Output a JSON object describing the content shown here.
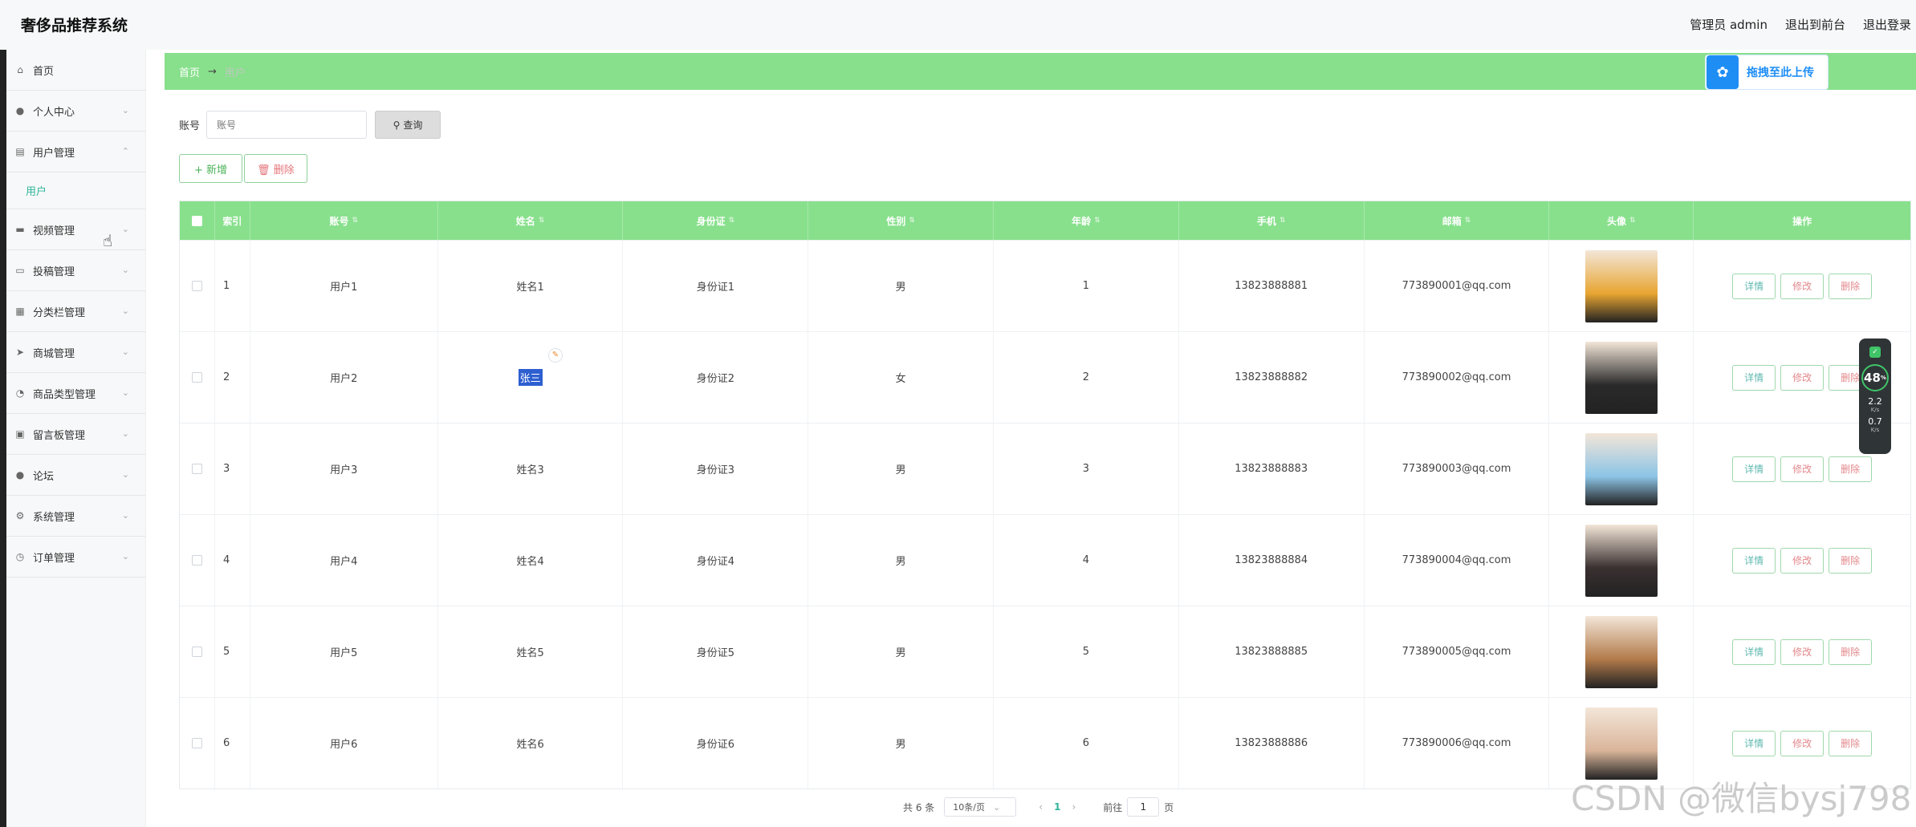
{
  "header": {
    "title": "奢侈品推荐系统",
    "links": [
      "管理员 admin",
      "退出到前台",
      "退出登录"
    ]
  },
  "sidebar": {
    "items": [
      {
        "label": "首页",
        "icon": "home-icon",
        "glyph": "⌂",
        "chev": ""
      },
      {
        "label": "个人中心",
        "icon": "user-icon",
        "glyph": "●",
        "chev": "⌄"
      },
      {
        "label": "用户管理",
        "icon": "clipboard-icon",
        "glyph": "▤",
        "chev": "⌃"
      },
      {
        "label": "视频管理",
        "icon": "briefcase-icon",
        "glyph": "▬",
        "chev": "⌄"
      },
      {
        "label": "投稿管理",
        "icon": "ticket-icon",
        "glyph": "▭",
        "chev": "⌄"
      },
      {
        "label": "分类栏管理",
        "icon": "grid-icon",
        "glyph": "▦",
        "chev": "⌄"
      },
      {
        "label": "商城管理",
        "icon": "send-icon",
        "glyph": "➤",
        "chev": "⌄"
      },
      {
        "label": "商品类型管理",
        "icon": "gauge-icon",
        "glyph": "◔",
        "chev": "⌄"
      },
      {
        "label": "留言板管理",
        "icon": "notebook-icon",
        "glyph": "▣",
        "chev": "⌄"
      },
      {
        "label": "论坛",
        "icon": "person-icon",
        "glyph": "●",
        "chev": "⌄"
      },
      {
        "label": "系统管理",
        "icon": "cog-icon",
        "glyph": "⚙",
        "chev": "⌄"
      },
      {
        "label": "订单管理",
        "icon": "clock-icon",
        "glyph": "◷",
        "chev": "⌄"
      }
    ],
    "sub_item": "用户"
  },
  "breadcrumb": {
    "home": "首页",
    "arrow": "→",
    "current": "用户"
  },
  "upload": {
    "label": "拖拽至此上传"
  },
  "search": {
    "label": "账号",
    "placeholder": "账号",
    "button": "查询"
  },
  "actions": {
    "add": "+ 新增",
    "delete": "🗑 删除"
  },
  "table": {
    "headers": [
      "索引",
      "账号",
      "姓名",
      "身份证",
      "性别",
      "年龄",
      "手机",
      "邮箱",
      "头像",
      "操作"
    ],
    "rows": [
      {
        "idx": "1",
        "acc": "用户1",
        "name": "姓名1",
        "id": "身份证1",
        "sex": "男",
        "age": "1",
        "phone": "13823888881",
        "mail": "773890001@qq.com",
        "av": "#e8a531"
      },
      {
        "idx": "2",
        "acc": "用户2",
        "name": "张三",
        "id": "身份证2",
        "sex": "女",
        "age": "2",
        "phone": "13823888882",
        "mail": "773890002@qq.com",
        "av": "#2a2a2a"
      },
      {
        "idx": "3",
        "acc": "用户3",
        "name": "姓名3",
        "id": "身份证3",
        "sex": "男",
        "age": "3",
        "phone": "13823888883",
        "mail": "773890003@qq.com",
        "av": "#8cc4e6"
      },
      {
        "idx": "4",
        "acc": "用户4",
        "name": "姓名4",
        "id": "身份证4",
        "sex": "男",
        "age": "4",
        "phone": "13823888884",
        "mail": "773890004@qq.com",
        "av": "#3a3030"
      },
      {
        "idx": "5",
        "acc": "用户5",
        "name": "姓名5",
        "id": "身份证5",
        "sex": "男",
        "age": "5",
        "phone": "13823888885",
        "mail": "773890005@qq.com",
        "av": "#b27a4a"
      },
      {
        "idx": "6",
        "acc": "用户6",
        "name": "姓名6",
        "id": "身份证6",
        "sex": "男",
        "age": "6",
        "phone": "13823888886",
        "mail": "773890006@qq.com",
        "av": "#d9b49a"
      }
    ],
    "ops": {
      "detail": "详情",
      "edit": "修改",
      "delete": "删除"
    }
  },
  "pager": {
    "total": "共 6 条",
    "size": "10条/页",
    "prev": "‹",
    "current": "1",
    "next": "›",
    "goto": "前往",
    "page_value": "1",
    "page_suffix": "页"
  },
  "widget": {
    "score": "48",
    "score_unit": "%",
    "up": "2.2",
    "down": "0.7",
    "unit": "K/s"
  },
  "watermark": "CSDN @微信bysj798"
}
